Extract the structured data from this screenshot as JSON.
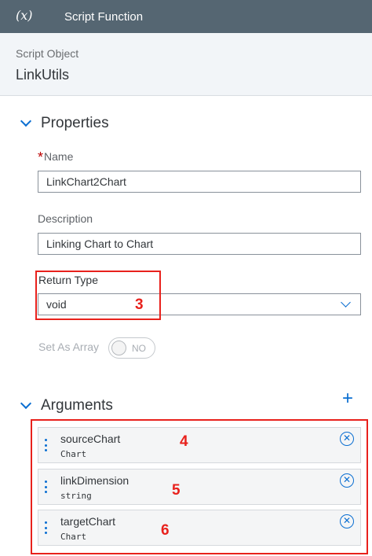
{
  "header": {
    "icon_text": "(x)",
    "title": "Script Function"
  },
  "object": {
    "label": "Script Object",
    "name": "LinkUtils"
  },
  "properties": {
    "section_title": "Properties",
    "name_required_mark": "*",
    "name_label": "Name",
    "name_value": "LinkChart2Chart",
    "description_label": "Description",
    "description_value": "Linking Chart to Chart",
    "return_type_label": "Return Type",
    "return_type_value": "void",
    "set_as_array_label": "Set As Array",
    "toggle_state": "NO"
  },
  "arguments": {
    "section_title": "Arguments",
    "add_symbol": "+",
    "items": [
      {
        "name": "sourceChart",
        "type": "Chart"
      },
      {
        "name": "linkDimension",
        "type": "string"
      },
      {
        "name": "targetChart",
        "type": "Chart"
      }
    ]
  },
  "annotations": {
    "marker_1": "3",
    "marker_2": "4",
    "marker_3": "5",
    "marker_4": "6"
  },
  "colors": {
    "header_bg": "#556672",
    "accent": "#0a6ed1",
    "annotation_red": "#e8211c"
  },
  "icons": {
    "collapse": "chevron-down-icon",
    "dropdown": "chevron-down-icon",
    "add": "plus-icon",
    "remove": "circle-x-icon",
    "drag": "drag-handle-icon",
    "function": "function-x-icon"
  }
}
